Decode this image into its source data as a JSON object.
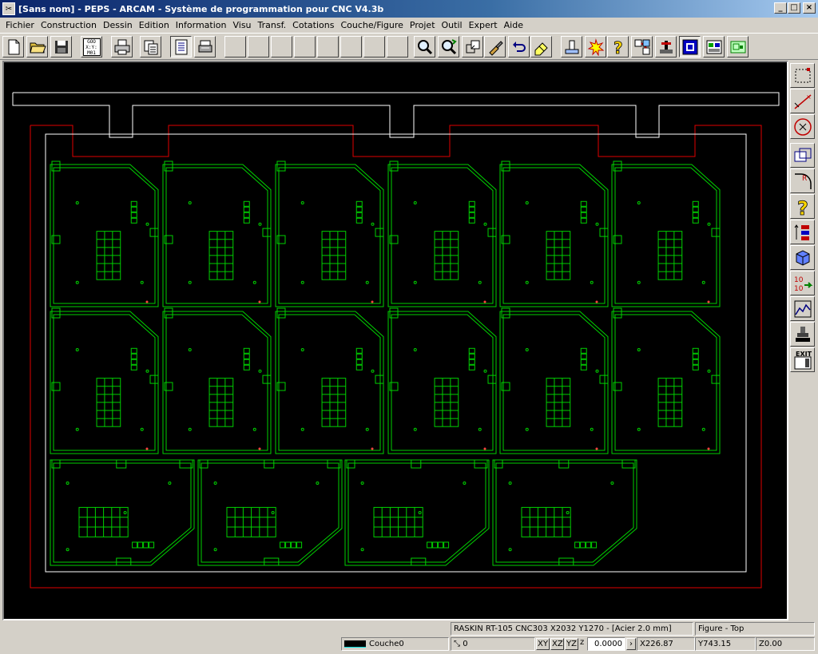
{
  "window": {
    "title": "[Sans nom] - PEPS - ARCAM - Système de programmation pour CNC V4.3b",
    "app_icon": "scissors-icon",
    "buttons": {
      "minimize": "_",
      "maximize": "□",
      "close": "×"
    }
  },
  "menu": [
    "Fichier",
    "Construction",
    "Dessin",
    "Edition",
    "Information",
    "Visu",
    "Transf.",
    "Cotations",
    "Couche/Figure",
    "Projet",
    "Outil",
    "Expert",
    "Aide"
  ],
  "toolbar": {
    "goo_label": [
      "GOO",
      "X:Y:",
      "M01"
    ],
    "buttons": [
      "new-file",
      "open-folder",
      "save-disk",
      "gcode-list",
      "print",
      "copy-pages",
      "view-page",
      "printer-setup",
      "blank",
      "blank",
      "blank",
      "blank",
      "blank",
      "blank",
      "blank",
      "blank",
      "zoom",
      "zoom-refresh",
      "zoom-window",
      "pan-brush",
      "undo",
      "eraser",
      "toolpath",
      "star-burst",
      "help",
      "compare",
      "machine",
      "select-window",
      "layers",
      "layout"
    ]
  },
  "right_tools": [
    "select-rectangle-icon",
    "line-icon",
    "circle-x-icon",
    "rectangle-icon",
    "radius-icon",
    "help-icon",
    "numbering-icon",
    "cube-icon",
    "sequence-icon",
    "chart-icon",
    "stamp-icon",
    "exit-icon"
  ],
  "right_exit_label": "EXIT",
  "status": {
    "machine": "RASKIN RT-105 CNC303 X2032  Y1270  - [Acier 2.0 mm]",
    "figure": "Figure - Top",
    "layer": "Couche0",
    "angle": "0",
    "plane_xy": "XY",
    "plane_xz": "XZ",
    "plane_yz": "YZ",
    "z_label": "z",
    "z_value": "0.0000",
    "x": "X226.87",
    "y": "Y743.15",
    "zcoord": "Z0.00"
  },
  "colors": {
    "part": "#00d000",
    "sheet": "#ffffff",
    "clamp": "#e00000",
    "background": "#000000"
  }
}
